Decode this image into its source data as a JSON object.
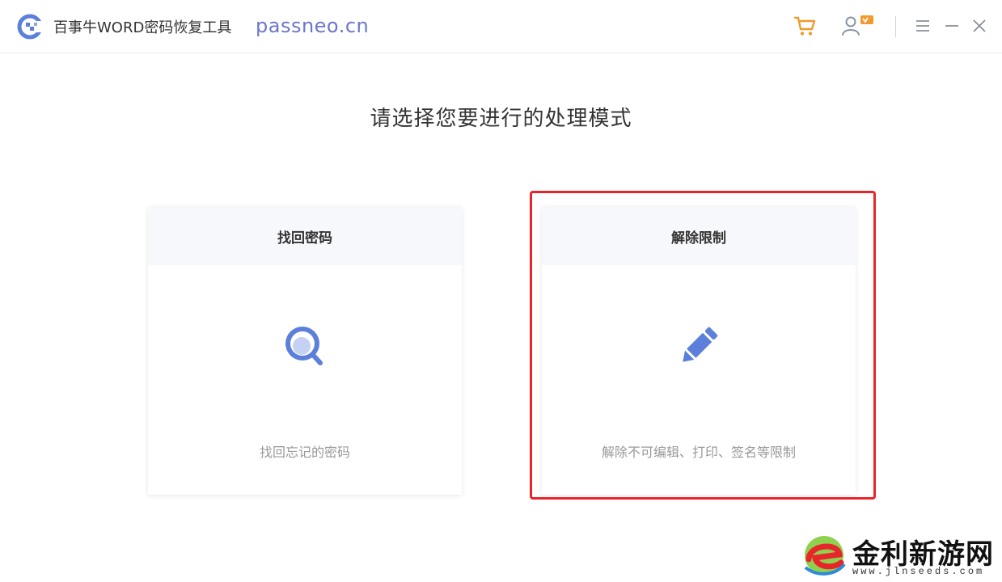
{
  "titlebar": {
    "app_title": "百事牛WORD密码恢复工具",
    "site_url": "passneo.cn",
    "icons": {
      "logo": "app-logo-icon",
      "cart": "cart-icon",
      "user": "user-vip-icon",
      "menu": "menu-icon",
      "minimize": "minimize-icon",
      "close": "close-icon"
    }
  },
  "main": {
    "heading": "请选择您要进行的处理模式",
    "cards": [
      {
        "title": "找回密码",
        "icon": "magnifier-icon",
        "description": "找回忘记的密码"
      },
      {
        "title": "解除限制",
        "icon": "pencil-icon",
        "description": "解除不可编辑、打印、签名等限制"
      }
    ]
  },
  "watermark": {
    "text": "金利新游网",
    "subtext": "www.jlnseeds.com"
  },
  "colors": {
    "accent": "#5b7fdb",
    "icon_orange": "#f39a2e",
    "highlight": "#e8252a",
    "url": "#6b77c9"
  }
}
